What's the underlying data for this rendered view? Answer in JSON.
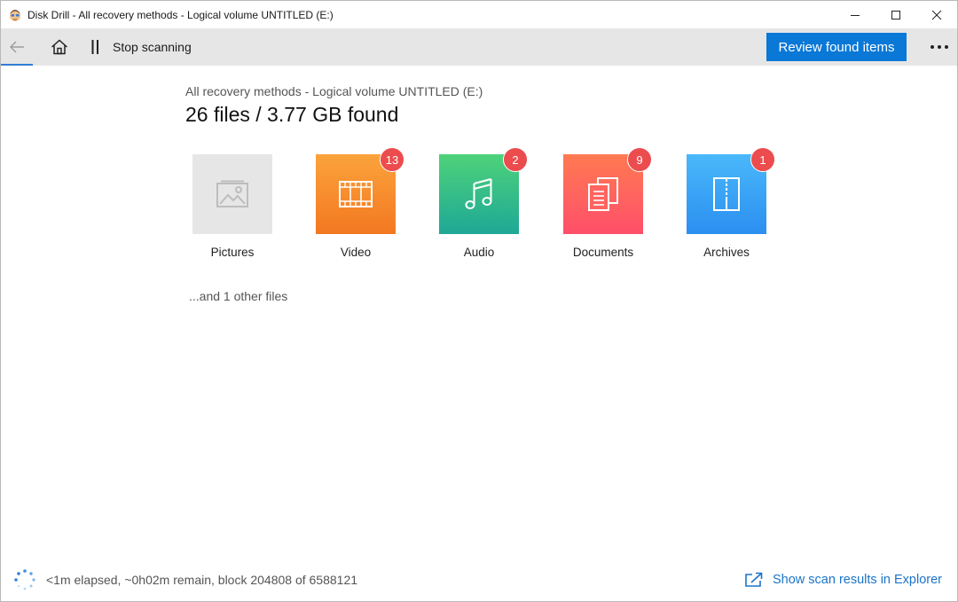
{
  "window": {
    "title": "Disk Drill - All recovery methods - Logical volume UNTITLED (E:)",
    "icon": "disk-drill-app-icon"
  },
  "toolbar": {
    "stop_label": "Stop scanning",
    "review_label": "Review found items",
    "icons": [
      "back-arrow-icon",
      "home-icon",
      "pause-icon",
      "more-icon"
    ]
  },
  "main": {
    "breadcrumb": "All recovery methods - Logical volume UNTITLED (E:)",
    "headline": "26 files / 3.77 GB found",
    "tiles": [
      {
        "label": "Pictures",
        "badge": "",
        "icon": "image-icon",
        "color": "#e6e6e6"
      },
      {
        "label": "Video",
        "badge": "13",
        "icon": "film-icon",
        "color": "#f6882a"
      },
      {
        "label": "Audio",
        "badge": "2",
        "icon": "music-note-icon",
        "color": "#2fbf8c"
      },
      {
        "label": "Documents",
        "badge": "9",
        "icon": "document-icon",
        "color": "#ff6460"
      },
      {
        "label": "Archives",
        "badge": "1",
        "icon": "archive-icon",
        "color": "#3aa2f4"
      }
    ],
    "other_files": "...and 1 other files"
  },
  "status": {
    "progress_text": "<1m elapsed, ~0h02m remain, block 204808 of 6588121",
    "show_results_label": "Show scan results in Explorer"
  },
  "colors": {
    "accent": "#0a78d6",
    "badge": "#ec4c4e",
    "link": "#1a74c9"
  }
}
